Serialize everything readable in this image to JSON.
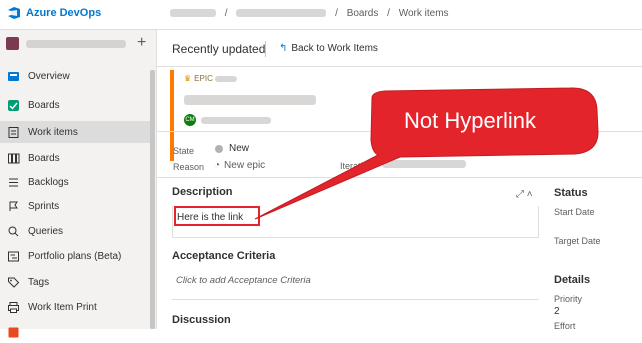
{
  "brand": {
    "name": "Azure DevOps"
  },
  "breadcrumb": {
    "boards": "Boards",
    "separator": "/",
    "work_items": "Work items"
  },
  "sidebar": {
    "items": [
      {
        "label": "Overview",
        "icon": "overview-icon"
      },
      {
        "label": "Boards",
        "icon": "boards-app-icon"
      },
      {
        "label": "Work items",
        "icon": "work-items-icon"
      },
      {
        "label": "Boards",
        "icon": "board-grid-icon"
      },
      {
        "label": "Backlogs",
        "icon": "backlog-icon"
      },
      {
        "label": "Sprints",
        "icon": "sprint-icon"
      },
      {
        "label": "Queries",
        "icon": "query-icon"
      },
      {
        "label": "Portfolio plans (Beta)",
        "icon": "portfolio-icon"
      },
      {
        "label": "Tags",
        "icon": "tag-icon"
      },
      {
        "label": "Work Item Print",
        "icon": "print-icon"
      }
    ]
  },
  "toolbar": {
    "recent": "Recently updated",
    "back": "Back to Work Items"
  },
  "work_item": {
    "type_label": "EPIC",
    "state_label": "State",
    "state_value": "New",
    "reason_label": "Reason",
    "reason_value": "New epic",
    "iteration_label": "Iteration",
    "owner_initials": "CM"
  },
  "sections": {
    "description": "Description",
    "description_text": "Here is the link",
    "acceptance": "Acceptance Criteria",
    "acceptance_placeholder": "Click to add Acceptance Criteria",
    "discussion": "Discussion",
    "status": "Status",
    "start_date": "Start Date",
    "target_date": "Target Date",
    "details": "Details",
    "priority": "Priority",
    "priority_value": "2",
    "effort": "Effort"
  },
  "callout": {
    "text": "Not Hyperlink"
  },
  "colors": {
    "accent": "#0078d4",
    "epic": "#ff7b00",
    "callout": "#e3242b"
  }
}
